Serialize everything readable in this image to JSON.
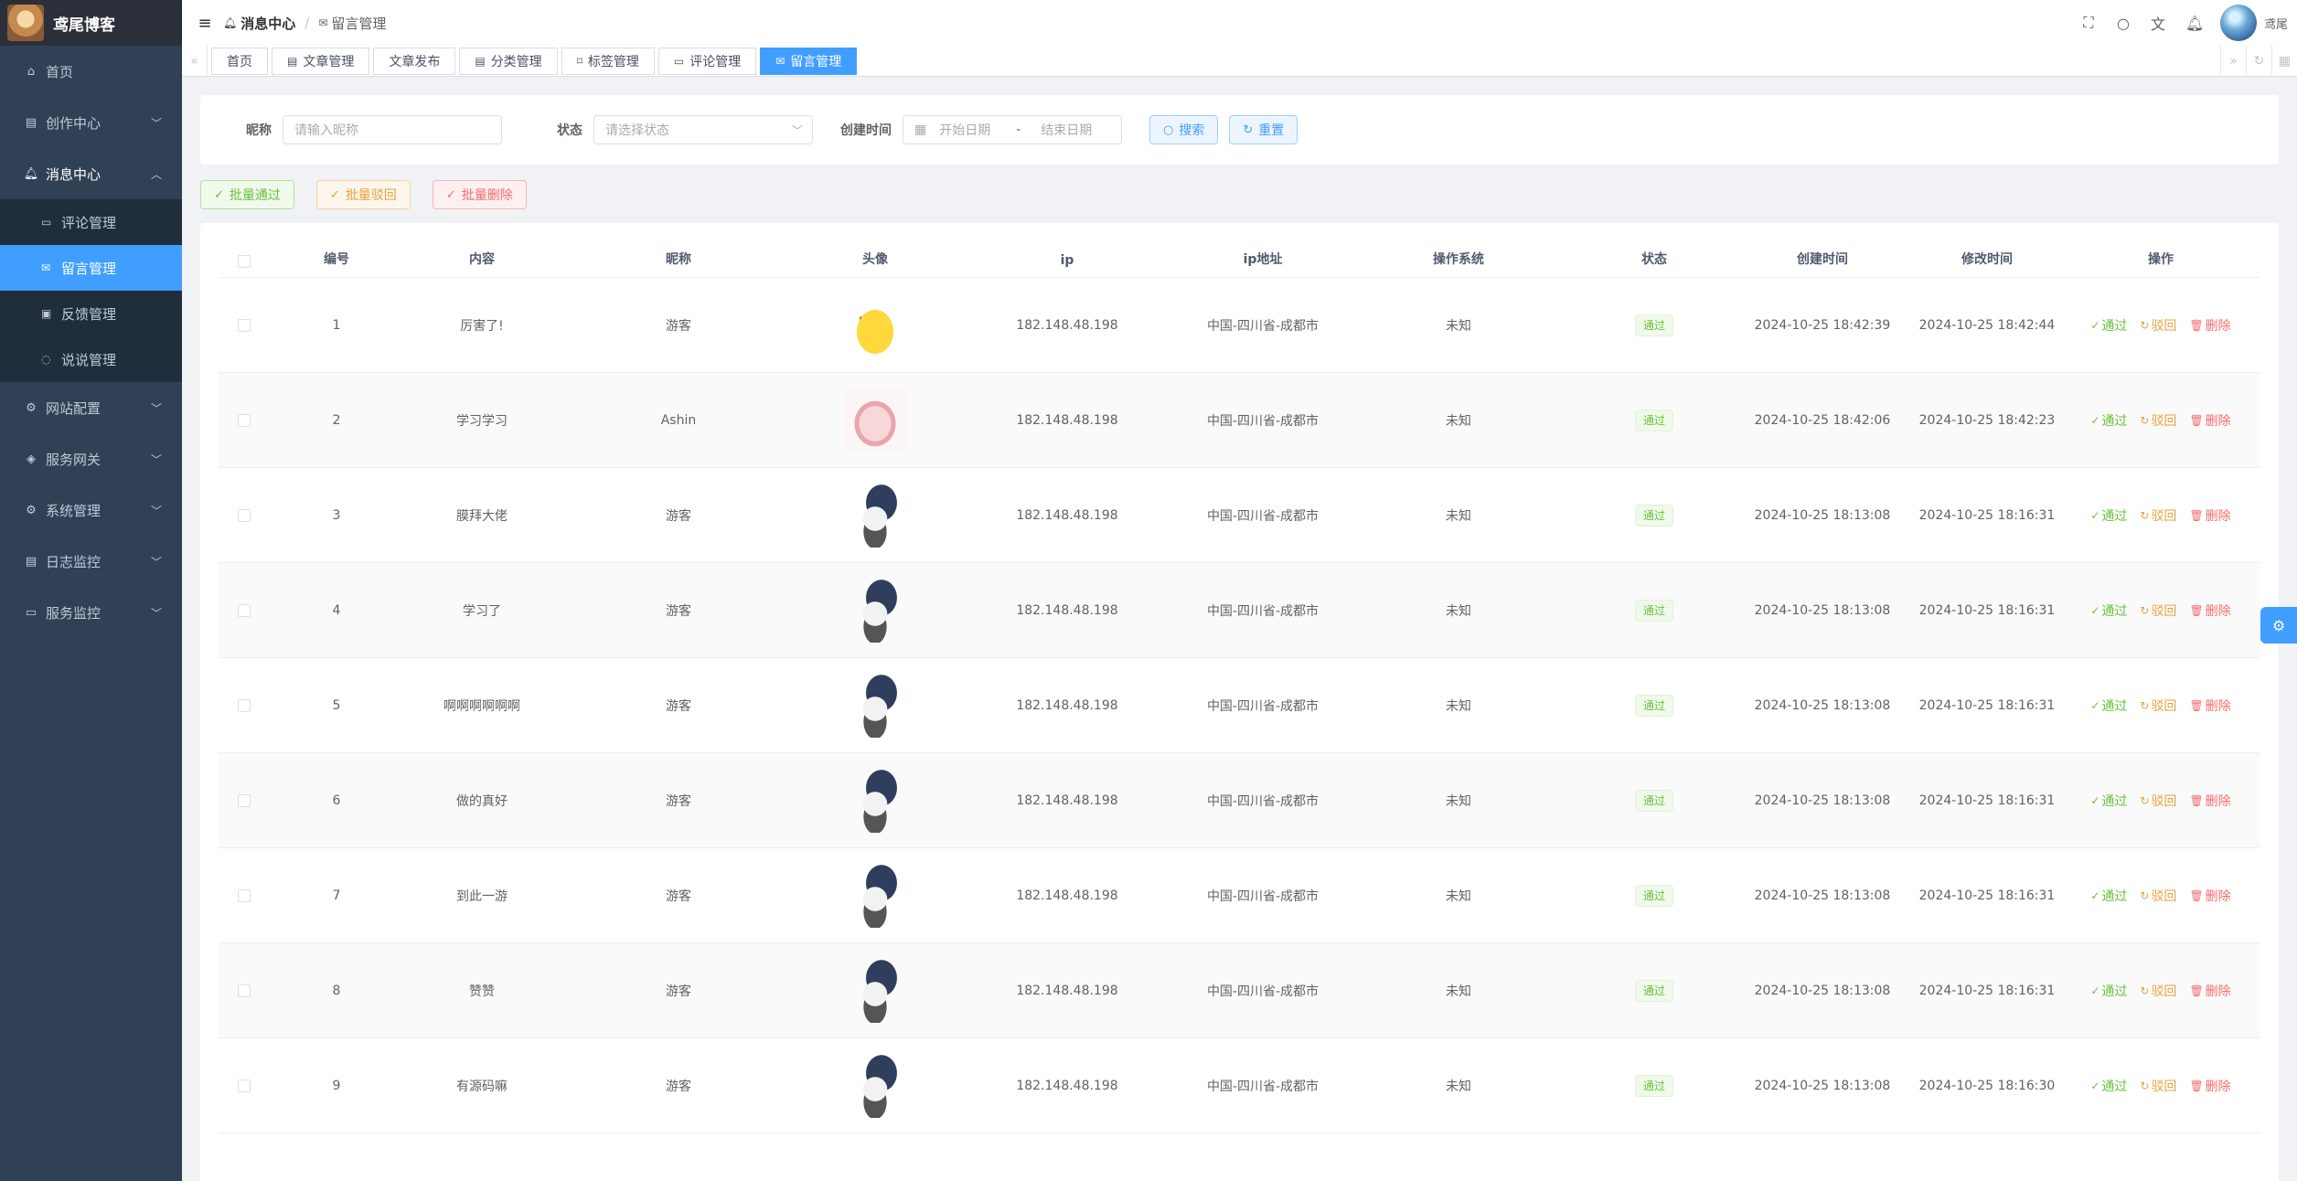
{
  "app": {
    "title": "鸢尾博客"
  },
  "sidebar": {
    "items": [
      {
        "label": "首页",
        "icon": "home-icon"
      },
      {
        "label": "创作中心",
        "icon": "document-icon"
      },
      {
        "label": "消息中心",
        "icon": "bell-icon"
      },
      {
        "label": "网站配置",
        "icon": "gear-icon"
      },
      {
        "label": "服务网关",
        "icon": "gateway-icon"
      },
      {
        "label": "系统管理",
        "icon": "gear-icon"
      },
      {
        "label": "日志监控",
        "icon": "document-icon"
      },
      {
        "label": "服务监控",
        "icon": "monitor-icon"
      }
    ],
    "submenu": [
      {
        "label": "评论管理",
        "icon": "comment-icon"
      },
      {
        "label": "留言管理",
        "icon": "mail-icon"
      },
      {
        "label": "反馈管理",
        "icon": "feedback-icon"
      },
      {
        "label": "说说管理",
        "icon": "chat-icon"
      }
    ]
  },
  "navbar": {
    "breadcrumb": [
      "消息中心",
      "留言管理"
    ],
    "user_name": "鸢尾"
  },
  "tags": [
    "首页",
    "文章管理",
    "文章发布",
    "分类管理",
    "标签管理",
    "评论管理",
    "留言管理"
  ],
  "search": {
    "nick_label": "昵称",
    "nick_placeholder": "请输入昵称",
    "status_label": "状态",
    "status_placeholder": "请选择状态",
    "time_label": "创建时间",
    "start_placeholder": "开始日期",
    "end_placeholder": "结束日期",
    "search_btn": "搜索",
    "reset_btn": "重置"
  },
  "batch": {
    "approve": "批量通过",
    "reject": "批量驳回",
    "delete": "批量删除"
  },
  "table": {
    "columns": [
      "编号",
      "内容",
      "昵称",
      "头像",
      "ip",
      "ip地址",
      "操作系统",
      "状态",
      "创建时间",
      "修改时间",
      "操作"
    ],
    "rows": [
      {
        "id": "1",
        "content": "厉害了!",
        "nick": "游客",
        "ip": "182.148.48.198",
        "addr": "中国-四川省-成都市",
        "os": "未知",
        "status": "通过",
        "ctime": "2024-10-25 18:42:39",
        "mtime": "2024-10-25 18:42:44"
      },
      {
        "id": "2",
        "content": "学习学习",
        "nick": "Ashin",
        "ip": "182.148.48.198",
        "addr": "中国-四川省-成都市",
        "os": "未知",
        "status": "通过",
        "ctime": "2024-10-25 18:42:06",
        "mtime": "2024-10-25 18:42:23"
      },
      {
        "id": "3",
        "content": "膜拜大佬",
        "nick": "游客",
        "ip": "182.148.48.198",
        "addr": "中国-四川省-成都市",
        "os": "未知",
        "status": "通过",
        "ctime": "2024-10-25 18:13:08",
        "mtime": "2024-10-25 18:16:31"
      },
      {
        "id": "4",
        "content": "学习了",
        "nick": "游客",
        "ip": "182.148.48.198",
        "addr": "中国-四川省-成都市",
        "os": "未知",
        "status": "通过",
        "ctime": "2024-10-25 18:13:08",
        "mtime": "2024-10-25 18:16:31"
      },
      {
        "id": "5",
        "content": "啊啊啊啊啊啊",
        "nick": "游客",
        "ip": "182.148.48.198",
        "addr": "中国-四川省-成都市",
        "os": "未知",
        "status": "通过",
        "ctime": "2024-10-25 18:13:08",
        "mtime": "2024-10-25 18:16:31"
      },
      {
        "id": "6",
        "content": "做的真好",
        "nick": "游客",
        "ip": "182.148.48.198",
        "addr": "中国-四川省-成都市",
        "os": "未知",
        "status": "通过",
        "ctime": "2024-10-25 18:13:08",
        "mtime": "2024-10-25 18:16:31"
      },
      {
        "id": "7",
        "content": "到此一游",
        "nick": "游客",
        "ip": "182.148.48.198",
        "addr": "中国-四川省-成都市",
        "os": "未知",
        "status": "通过",
        "ctime": "2024-10-25 18:13:08",
        "mtime": "2024-10-25 18:16:31"
      },
      {
        "id": "8",
        "content": "赞赞",
        "nick": "游客",
        "ip": "182.148.48.198",
        "addr": "中国-四川省-成都市",
        "os": "未知",
        "status": "通过",
        "ctime": "2024-10-25 18:13:08",
        "mtime": "2024-10-25 18:16:31"
      },
      {
        "id": "9",
        "content": "有源码嘛",
        "nick": "游客",
        "ip": "182.148.48.198",
        "addr": "中国-四川省-成都市",
        "os": "未知",
        "status": "通过",
        "ctime": "2024-10-25 18:13:08",
        "mtime": "2024-10-25 18:16:30"
      }
    ],
    "ops": {
      "approve": "通过",
      "reject": "驳回",
      "delete": "删除"
    }
  },
  "colors": {
    "primary": "#409eff",
    "success": "#67c23a",
    "warning": "#e6a23c",
    "danger": "#f56c6c",
    "sidebar": "#304156"
  }
}
